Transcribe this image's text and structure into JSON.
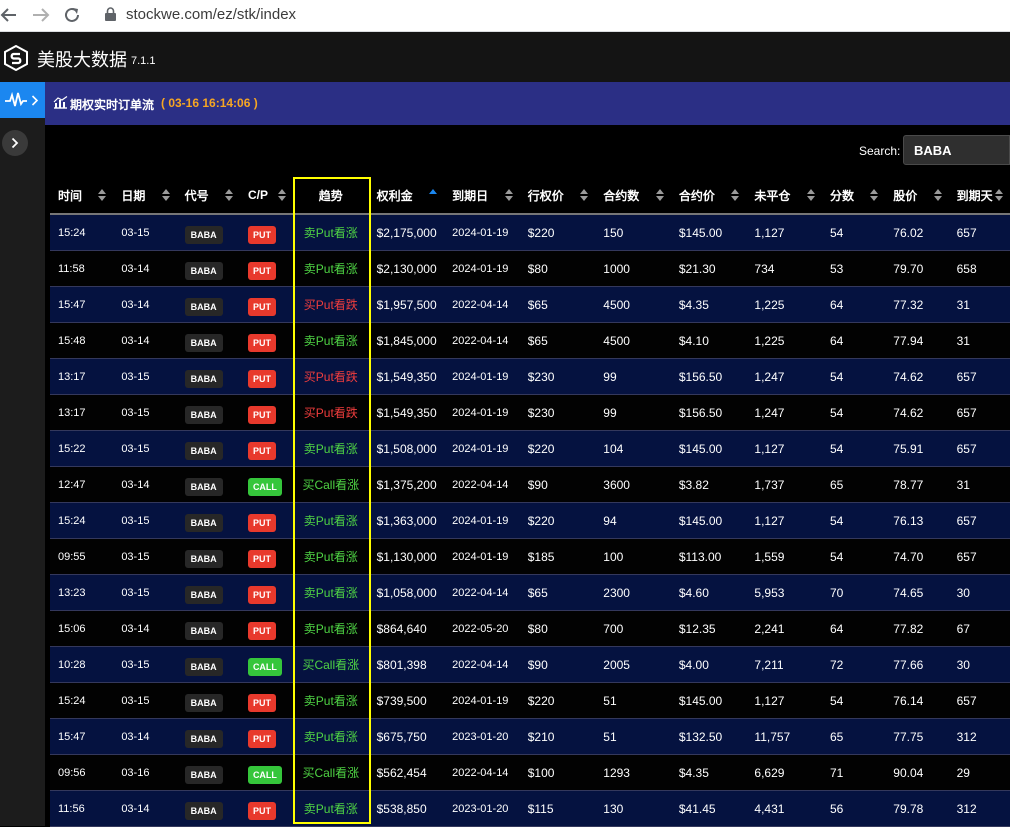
{
  "browser": {
    "url": "stockwe.com/ez/stk/index"
  },
  "app": {
    "title": "美股大数据",
    "version": "7.1.1"
  },
  "panel": {
    "title": "期权实时订单流",
    "time": "( 03-16 16:14:06 )"
  },
  "search": {
    "label": "Search:",
    "value": "BABA"
  },
  "table": {
    "columns": [
      "时间",
      "日期",
      "代号",
      "C/P",
      "趋势",
      "权利金",
      "到期日",
      "行权价",
      "合约数",
      "合约价",
      "未平仓",
      "分数",
      "股价",
      "到期天"
    ],
    "sorted_column": "权利金",
    "rows": [
      {
        "time": "15:24",
        "date": "03-15",
        "sym": "BABA",
        "cp": "PUT",
        "trend": "卖Put看涨",
        "trend_dir": "up",
        "premium": "$2,175,000",
        "exp": "2024-01-19",
        "strike": "$220",
        "qty": "150",
        "price": "$145.00",
        "oi": "1,127",
        "score": "54",
        "stock": "76.02",
        "days": "657"
      },
      {
        "time": "11:58",
        "date": "03-14",
        "sym": "BABA",
        "cp": "PUT",
        "trend": "卖Put看涨",
        "trend_dir": "up",
        "premium": "$2,130,000",
        "exp": "2024-01-19",
        "strike": "$80",
        "qty": "1000",
        "price": "$21.30",
        "oi": "734",
        "score": "53",
        "stock": "79.70",
        "days": "658"
      },
      {
        "time": "15:47",
        "date": "03-14",
        "sym": "BABA",
        "cp": "PUT",
        "trend": "买Put看跌",
        "trend_dir": "down",
        "premium": "$1,957,500",
        "exp": "2022-04-14",
        "strike": "$65",
        "qty": "4500",
        "price": "$4.35",
        "oi": "1,225",
        "score": "64",
        "stock": "77.32",
        "days": "31"
      },
      {
        "time": "15:48",
        "date": "03-14",
        "sym": "BABA",
        "cp": "PUT",
        "trend": "卖Put看涨",
        "trend_dir": "up",
        "premium": "$1,845,000",
        "exp": "2022-04-14",
        "strike": "$65",
        "qty": "4500",
        "price": "$4.10",
        "oi": "1,225",
        "score": "64",
        "stock": "77.94",
        "days": "31"
      },
      {
        "time": "13:17",
        "date": "03-15",
        "sym": "BABA",
        "cp": "PUT",
        "trend": "买Put看跌",
        "trend_dir": "down",
        "premium": "$1,549,350",
        "exp": "2024-01-19",
        "strike": "$230",
        "qty": "99",
        "price": "$156.50",
        "oi": "1,247",
        "score": "54",
        "stock": "74.62",
        "days": "657"
      },
      {
        "time": "13:17",
        "date": "03-15",
        "sym": "BABA",
        "cp": "PUT",
        "trend": "买Put看跌",
        "trend_dir": "down",
        "premium": "$1,549,350",
        "exp": "2024-01-19",
        "strike": "$230",
        "qty": "99",
        "price": "$156.50",
        "oi": "1,247",
        "score": "54",
        "stock": "74.62",
        "days": "657"
      },
      {
        "time": "15:22",
        "date": "03-15",
        "sym": "BABA",
        "cp": "PUT",
        "trend": "卖Put看涨",
        "trend_dir": "up",
        "premium": "$1,508,000",
        "exp": "2024-01-19",
        "strike": "$220",
        "qty": "104",
        "price": "$145.00",
        "oi": "1,127",
        "score": "54",
        "stock": "75.91",
        "days": "657"
      },
      {
        "time": "12:47",
        "date": "03-14",
        "sym": "BABA",
        "cp": "CALL",
        "trend": "买Call看涨",
        "trend_dir": "up",
        "premium": "$1,375,200",
        "exp": "2022-04-14",
        "strike": "$90",
        "qty": "3600",
        "price": "$3.82",
        "oi": "1,737",
        "score": "65",
        "stock": "78.77",
        "days": "31"
      },
      {
        "time": "15:24",
        "date": "03-15",
        "sym": "BABA",
        "cp": "PUT",
        "trend": "卖Put看涨",
        "trend_dir": "up",
        "premium": "$1,363,000",
        "exp": "2024-01-19",
        "strike": "$220",
        "qty": "94",
        "price": "$145.00",
        "oi": "1,127",
        "score": "54",
        "stock": "76.13",
        "days": "657"
      },
      {
        "time": "09:55",
        "date": "03-15",
        "sym": "BABA",
        "cp": "PUT",
        "trend": "卖Put看涨",
        "trend_dir": "up",
        "premium": "$1,130,000",
        "exp": "2024-01-19",
        "strike": "$185",
        "qty": "100",
        "price": "$113.00",
        "oi": "1,559",
        "score": "54",
        "stock": "74.70",
        "days": "657"
      },
      {
        "time": "13:23",
        "date": "03-15",
        "sym": "BABA",
        "cp": "PUT",
        "trend": "卖Put看涨",
        "trend_dir": "up",
        "premium": "$1,058,000",
        "exp": "2022-04-14",
        "strike": "$65",
        "qty": "2300",
        "price": "$4.60",
        "oi": "5,953",
        "score": "70",
        "stock": "74.65",
        "days": "30"
      },
      {
        "time": "15:06",
        "date": "03-14",
        "sym": "BABA",
        "cp": "PUT",
        "trend": "卖Put看涨",
        "trend_dir": "up",
        "premium": "$864,640",
        "exp": "2022-05-20",
        "strike": "$80",
        "qty": "700",
        "price": "$12.35",
        "oi": "2,241",
        "score": "64",
        "stock": "77.82",
        "days": "67"
      },
      {
        "time": "10:28",
        "date": "03-15",
        "sym": "BABA",
        "cp": "CALL",
        "trend": "买Call看涨",
        "trend_dir": "up",
        "premium": "$801,398",
        "exp": "2022-04-14",
        "strike": "$90",
        "qty": "2005",
        "price": "$4.00",
        "oi": "7,211",
        "score": "72",
        "stock": "77.66",
        "days": "30"
      },
      {
        "time": "15:24",
        "date": "03-15",
        "sym": "BABA",
        "cp": "PUT",
        "trend": "卖Put看涨",
        "trend_dir": "up",
        "premium": "$739,500",
        "exp": "2024-01-19",
        "strike": "$220",
        "qty": "51",
        "price": "$145.00",
        "oi": "1,127",
        "score": "54",
        "stock": "76.14",
        "days": "657"
      },
      {
        "time": "15:47",
        "date": "03-14",
        "sym": "BABA",
        "cp": "PUT",
        "trend": "卖Put看涨",
        "trend_dir": "up",
        "premium": "$675,750",
        "exp": "2023-01-20",
        "strike": "$210",
        "qty": "51",
        "price": "$132.50",
        "oi": "11,757",
        "score": "65",
        "stock": "77.75",
        "days": "312"
      },
      {
        "time": "09:56",
        "date": "03-16",
        "sym": "BABA",
        "cp": "CALL",
        "trend": "买Call看涨",
        "trend_dir": "up",
        "premium": "$562,454",
        "exp": "2022-04-14",
        "strike": "$100",
        "qty": "1293",
        "price": "$4.35",
        "oi": "6,629",
        "score": "71",
        "stock": "90.04",
        "days": "29"
      },
      {
        "time": "11:56",
        "date": "03-14",
        "sym": "BABA",
        "cp": "PUT",
        "trend": "卖Put看涨",
        "trend_dir": "up",
        "premium": "$538,850",
        "exp": "2023-01-20",
        "strike": "$115",
        "qty": "130",
        "price": "$41.45",
        "oi": "4,431",
        "score": "56",
        "stock": "79.78",
        "days": "312"
      }
    ]
  },
  "colors": {
    "accent": "#1b87f0",
    "header_band": "#2b2f85",
    "time_text": "#f6a623",
    "up": "#4fd444",
    "down": "#f03d3d",
    "put_tag": "#e8392c",
    "call_tag": "#35c63b",
    "highlight_box": "#ffff00"
  },
  "icons": {
    "back": "arrow-left-icon",
    "forward": "arrow-right-icon",
    "reload": "reload-icon",
    "lock": "lock-icon",
    "logo": "s-logo-icon",
    "rail": "pulse-icon",
    "panel": "chart-icon",
    "sort": "sort-arrows-icon"
  }
}
